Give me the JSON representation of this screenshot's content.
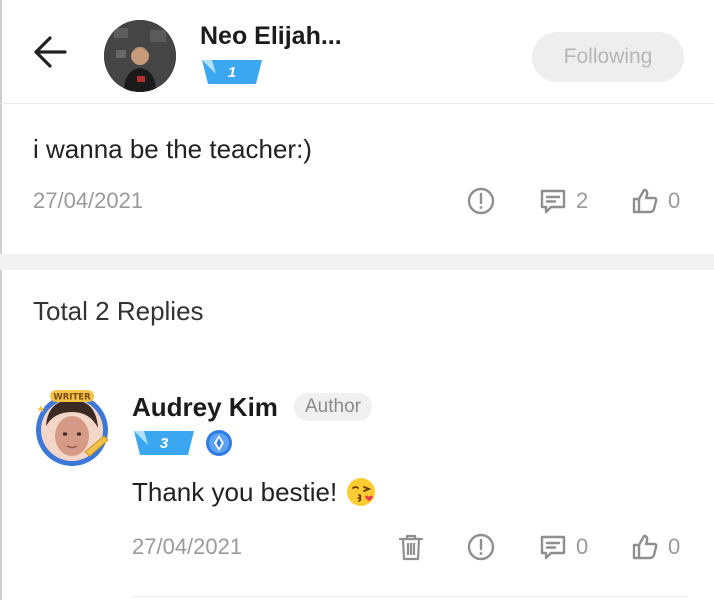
{
  "header": {
    "user_name": "Neo Elijah...",
    "level": "1",
    "follow_label": "Following"
  },
  "post": {
    "text": "i wanna be the teacher:)",
    "date": "27/04/2021",
    "comment_count": "2",
    "like_count": "0"
  },
  "replies": {
    "title": "Total 2 Replies",
    "items": [
      {
        "name": "Audrey Kim",
        "tag": "Author",
        "level": "3",
        "text": "Thank you bestie!",
        "date": "27/04/2021",
        "comment_count": "0",
        "like_count": "0",
        "avatar_frame_label": "WRITER"
      }
    ]
  },
  "icons": {
    "back": "arrow-left-icon",
    "report": "exclamation-circle-icon",
    "comment": "comment-icon",
    "like": "thumbs-up-icon",
    "delete": "trash-icon",
    "crown": "crown-badge-icon",
    "emoji": "kissing-face-emoji"
  },
  "colors": {
    "badge_blue": "#3aa7f0",
    "muted_text": "#9a9a9a",
    "following_bg": "#eeeeee"
  }
}
